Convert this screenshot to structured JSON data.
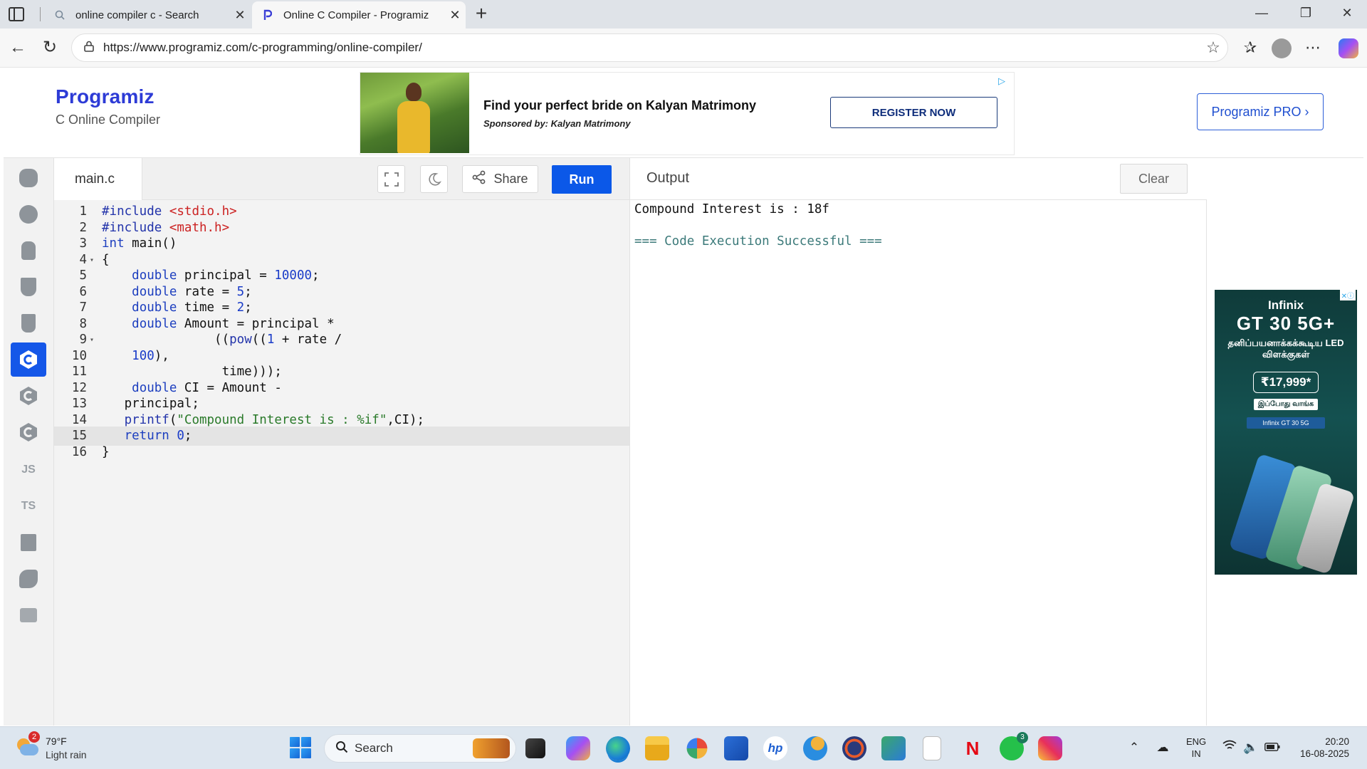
{
  "browser": {
    "tabs": [
      {
        "title": "online compiler c - Search",
        "icon": "search-icon",
        "active": false
      },
      {
        "title": "Online C Compiler - Programiz",
        "icon": "programiz-favicon",
        "active": true
      }
    ],
    "url": "https://www.programiz.com/c-programming/online-compiler/"
  },
  "header": {
    "brand": "Programiz",
    "subtitle": "C Online Compiler",
    "pro_button": "Programiz PRO ›"
  },
  "ad": {
    "title": "Find your perfect bride on Kalyan Matrimony",
    "sponsor": "Sponsored by: Kalyan Matrimony",
    "cta": "REGISTER NOW"
  },
  "sidebar": {
    "languages": [
      {
        "name": "python-icon",
        "label": ""
      },
      {
        "name": "r-icon",
        "label": ""
      },
      {
        "name": "sql-icon",
        "label": ""
      },
      {
        "name": "html-icon",
        "label": ""
      },
      {
        "name": "java-icon",
        "label": ""
      },
      {
        "name": "c-icon",
        "label": "",
        "active": true
      },
      {
        "name": "cpp-icon",
        "label": ""
      },
      {
        "name": "csharp-icon",
        "label": ""
      },
      {
        "name": "js-icon",
        "label": "JS"
      },
      {
        "name": "ts-icon",
        "label": "TS"
      },
      {
        "name": "go-icon",
        "label": ""
      },
      {
        "name": "swift-icon",
        "label": ""
      },
      {
        "name": "rust-icon",
        "label": ""
      }
    ]
  },
  "editor": {
    "filename": "main.c",
    "share_label": "Share",
    "run_label": "Run",
    "current_line": 15,
    "lines": [
      {
        "n": "1",
        "fold": "",
        "text": "#include <stdio.h>"
      },
      {
        "n": "2",
        "fold": "",
        "text": "#include <math.h>"
      },
      {
        "n": "3",
        "fold": "",
        "text": "int main()"
      },
      {
        "n": "4",
        "fold": "▾",
        "text": "{"
      },
      {
        "n": "5",
        "fold": "",
        "text": "    double principal = 10000;"
      },
      {
        "n": "6",
        "fold": "",
        "text": "    double rate = 5;"
      },
      {
        "n": "7",
        "fold": "",
        "text": "    double time = 2;"
      },
      {
        "n": "8",
        "fold": "",
        "text": "    double Amount = principal *"
      },
      {
        "n": "9",
        "fold": "▾",
        "text": "               ((pow((1 + rate /"
      },
      {
        "n": "10",
        "fold": "",
        "text": "    100),"
      },
      {
        "n": "11",
        "fold": "",
        "text": "                time)));"
      },
      {
        "n": "12",
        "fold": "",
        "text": "    double CI = Amount -"
      },
      {
        "n": "13",
        "fold": "",
        "text": "   principal;"
      },
      {
        "n": "14",
        "fold": "",
        "text": "   printf(\"Compound Interest is : %if\",CI);"
      },
      {
        "n": "15",
        "fold": "",
        "text": "   return 0;"
      },
      {
        "n": "16",
        "fold": "",
        "text": "}"
      }
    ]
  },
  "output": {
    "title": "Output",
    "clear_label": "Clear",
    "lines": [
      {
        "text": "Compound Interest is : 18f",
        "kind": "stdout"
      },
      {
        "text": "=== Code Execution Successful ===",
        "kind": "success"
      }
    ]
  },
  "side_ad": {
    "brand": "Infinix",
    "model": "GT 30 5G+",
    "tagline": "தனிப்பயனாக்கக்கூடிய LED விளக்குகள்",
    "price": "₹17,999*",
    "buy": "இப்போது வாங்க",
    "search": "Infinix GT 30 5G"
  },
  "taskbar": {
    "weather_temp": "79°F",
    "weather_desc": "Light rain",
    "weather_badge": "2",
    "search_label": "Search",
    "whatsapp_badge": "3",
    "lang_line1": "ENG",
    "lang_line2": "IN",
    "time": "20:20",
    "date": "16-08-2025"
  }
}
